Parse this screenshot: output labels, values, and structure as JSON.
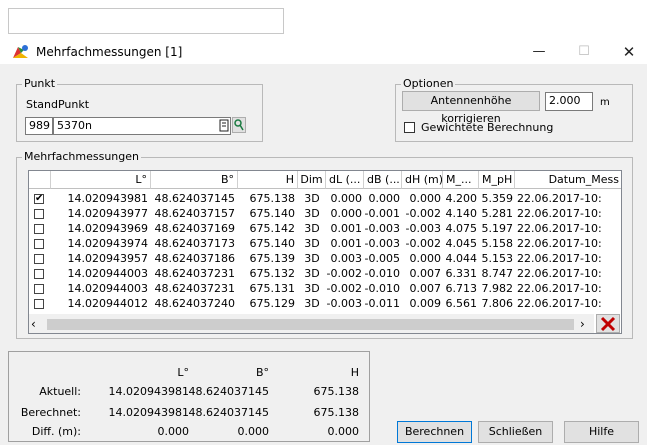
{
  "window": {
    "title": "Mehrfachmessungen [1]"
  },
  "punkt": {
    "legend": "Punkt",
    "standpunkt_label": "StandPunkt",
    "standpunkt_nr": "989",
    "standpunkt_name": "5370n"
  },
  "optionen": {
    "legend": "Optionen",
    "antennen_button": "Antennenhöhe korrigieren",
    "antennen_value": "2.000",
    "antennen_unit": "m",
    "gewichtete_label": "Gewichtete Berechnung",
    "gewichtete_checked": false
  },
  "messungen": {
    "legend": "Mehrfachmessungen",
    "columns": [
      "L°",
      "B°",
      "H",
      "Dim",
      "dL (...",
      "dB (...",
      "dH (m)",
      "M_...",
      "M_pH",
      "Datum_Mess"
    ],
    "rows": [
      {
        "checked": true,
        "L": "14.020943981",
        "B": "48.624037145",
        "H": "675.138",
        "Dim": "3D",
        "dL": "0.000",
        "dB": "0.000",
        "dH": "0.000",
        "M": "4.200",
        "MpH": "5.359",
        "Datum": "22.06.2017-10:"
      },
      {
        "checked": false,
        "L": "14.020943977",
        "B": "48.624037157",
        "H": "675.140",
        "Dim": "3D",
        "dL": "0.000",
        "dB": "-0.001",
        "dH": "-0.002",
        "M": "4.140",
        "MpH": "5.281",
        "Datum": "22.06.2017-10:"
      },
      {
        "checked": false,
        "L": "14.020943969",
        "B": "48.624037169",
        "H": "675.142",
        "Dim": "3D",
        "dL": "0.001",
        "dB": "-0.003",
        "dH": "-0.003",
        "M": "4.075",
        "MpH": "5.197",
        "Datum": "22.06.2017-10:"
      },
      {
        "checked": false,
        "L": "14.020943974",
        "B": "48.624037173",
        "H": "675.140",
        "Dim": "3D",
        "dL": "0.001",
        "dB": "-0.003",
        "dH": "-0.002",
        "M": "4.045",
        "MpH": "5.158",
        "Datum": "22.06.2017-10:"
      },
      {
        "checked": false,
        "L": "14.020943957",
        "B": "48.624037186",
        "H": "675.139",
        "Dim": "3D",
        "dL": "0.003",
        "dB": "-0.005",
        "dH": "0.000",
        "M": "4.044",
        "MpH": "5.153",
        "Datum": "22.06.2017-10:"
      },
      {
        "checked": false,
        "L": "14.020944003",
        "B": "48.624037231",
        "H": "675.132",
        "Dim": "3D",
        "dL": "-0.002",
        "dB": "-0.010",
        "dH": "0.007",
        "M": "6.331",
        "MpH": "8.747",
        "Datum": "22.06.2017-10:"
      },
      {
        "checked": false,
        "L": "14.020944003",
        "B": "48.624037231",
        "H": "675.131",
        "Dim": "3D",
        "dL": "-0.002",
        "dB": "-0.010",
        "dH": "0.007",
        "M": "6.713",
        "MpH": "7.982",
        "Datum": "22.06.2017-10:"
      },
      {
        "checked": false,
        "L": "14.020944012",
        "B": "48.624037240",
        "H": "675.129",
        "Dim": "3D",
        "dL": "-0.003",
        "dB": "-0.011",
        "dH": "0.009",
        "M": "6.561",
        "MpH": "7.806",
        "Datum": "22.06.2017-10:"
      }
    ]
  },
  "summary": {
    "headers": [
      "L°",
      "B°",
      "H"
    ],
    "rows": [
      {
        "label": "Aktuell:",
        "L": "14.020943981",
        "B": "48.624037145",
        "H": "675.138"
      },
      {
        "label": "Berechnet:",
        "L": "14.020943981",
        "B": "48.624037145",
        "H": "675.138"
      },
      {
        "label": "Diff. (m):",
        "L": "0.000",
        "B": "0.000",
        "H": "0.000"
      }
    ]
  },
  "buttons": {
    "berechnen": "Berechnen",
    "schliessen": "Schließen",
    "hilfe": "Hilfe"
  },
  "colors": {
    "delete_x": "#c00000",
    "check": "#000000"
  }
}
